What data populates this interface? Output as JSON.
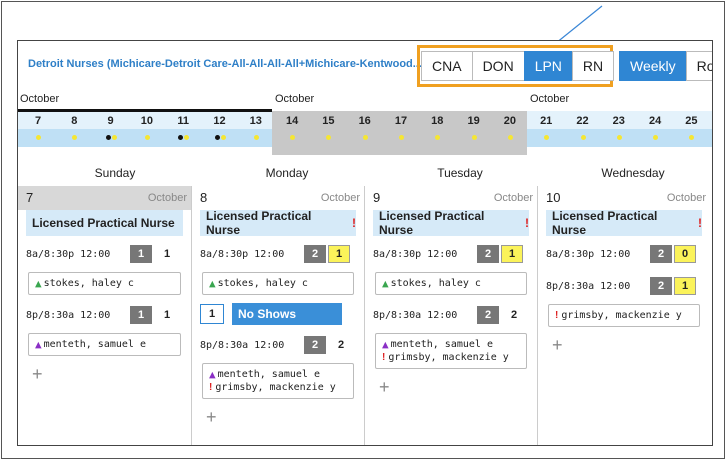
{
  "header": {
    "title": "Detroit Nurses (Michicare-Detroit Care-All-All-All-All+Michicare-Kentwood...",
    "roles": [
      {
        "label": "CNA",
        "active": false
      },
      {
        "label": "DON",
        "active": false
      },
      {
        "label": "LPN",
        "active": true
      },
      {
        "label": "RN",
        "active": false
      }
    ],
    "views": [
      {
        "label": "Weekly",
        "active": true
      },
      {
        "label": "Ro",
        "active": false
      }
    ]
  },
  "timeline": {
    "months": [
      "October",
      "October",
      "October"
    ],
    "dates": [
      "7",
      "8",
      "9",
      "10",
      "11",
      "12",
      "13",
      "14",
      "15",
      "16",
      "17",
      "18",
      "19",
      "20",
      "21",
      "22",
      "23",
      "24",
      "25"
    ]
  },
  "days": [
    "Sunday",
    "Monday",
    "Tuesday",
    "Wednesday"
  ],
  "columns": [
    {
      "num": "7",
      "month": "October",
      "role": "Licensed Practical Nurse",
      "alert": false,
      "shifts": [
        {
          "time": "8a/8:30p 12:00",
          "grey": "1",
          "yellow": "",
          "plain": "1",
          "people": [
            {
              "name": "stokes, haley c",
              "icon": "green"
            }
          ]
        },
        {
          "time": "8p/8:30a 12:00",
          "grey": "1",
          "yellow": "",
          "plain": "1",
          "people": [
            {
              "name": "menteth, samuel e",
              "icon": "purple"
            }
          ]
        }
      ]
    },
    {
      "num": "8",
      "month": "October",
      "role": "Licensed Practical Nurse",
      "alert": true,
      "shifts": [
        {
          "time": "8a/8:30p 12:00",
          "grey": "2",
          "yellow": "1",
          "plain": "",
          "people": [
            {
              "name": "stokes, haley c",
              "icon": "green"
            }
          ]
        },
        {
          "time": "8p/8:30a 12:00",
          "grey": "2",
          "yellow": "",
          "plain": "2",
          "people": [
            {
              "name": "menteth, samuel e",
              "icon": "purple"
            },
            {
              "name": "grimsby, mackenzie y",
              "icon": "red"
            }
          ]
        }
      ],
      "noshow": {
        "count": "1",
        "label": "No Shows"
      }
    },
    {
      "num": "9",
      "month": "October",
      "role": "Licensed Practical Nurse",
      "alert": true,
      "shifts": [
        {
          "time": "8a/8:30p 12:00",
          "grey": "2",
          "yellow": "1",
          "plain": "",
          "people": [
            {
              "name": "stokes, haley c",
              "icon": "green"
            }
          ]
        },
        {
          "time": "8p/8:30a 12:00",
          "grey": "2",
          "yellow": "",
          "plain": "2",
          "people": [
            {
              "name": "menteth, samuel e",
              "icon": "purple"
            },
            {
              "name": "grimsby, mackenzie y",
              "icon": "red"
            }
          ]
        }
      ]
    },
    {
      "num": "10",
      "month": "October",
      "role": "Licensed Practical Nurse",
      "alert": true,
      "shifts": [
        {
          "time": "8a/8:30p 12:00",
          "grey": "2",
          "yellow": "0",
          "plain": "",
          "people": []
        },
        {
          "time": "8p/8:30a 12:00",
          "grey": "2",
          "yellow": "1",
          "plain": "",
          "people": [
            {
              "name": "grimsby, mackenzie y",
              "icon": "red"
            }
          ]
        }
      ]
    }
  ]
}
